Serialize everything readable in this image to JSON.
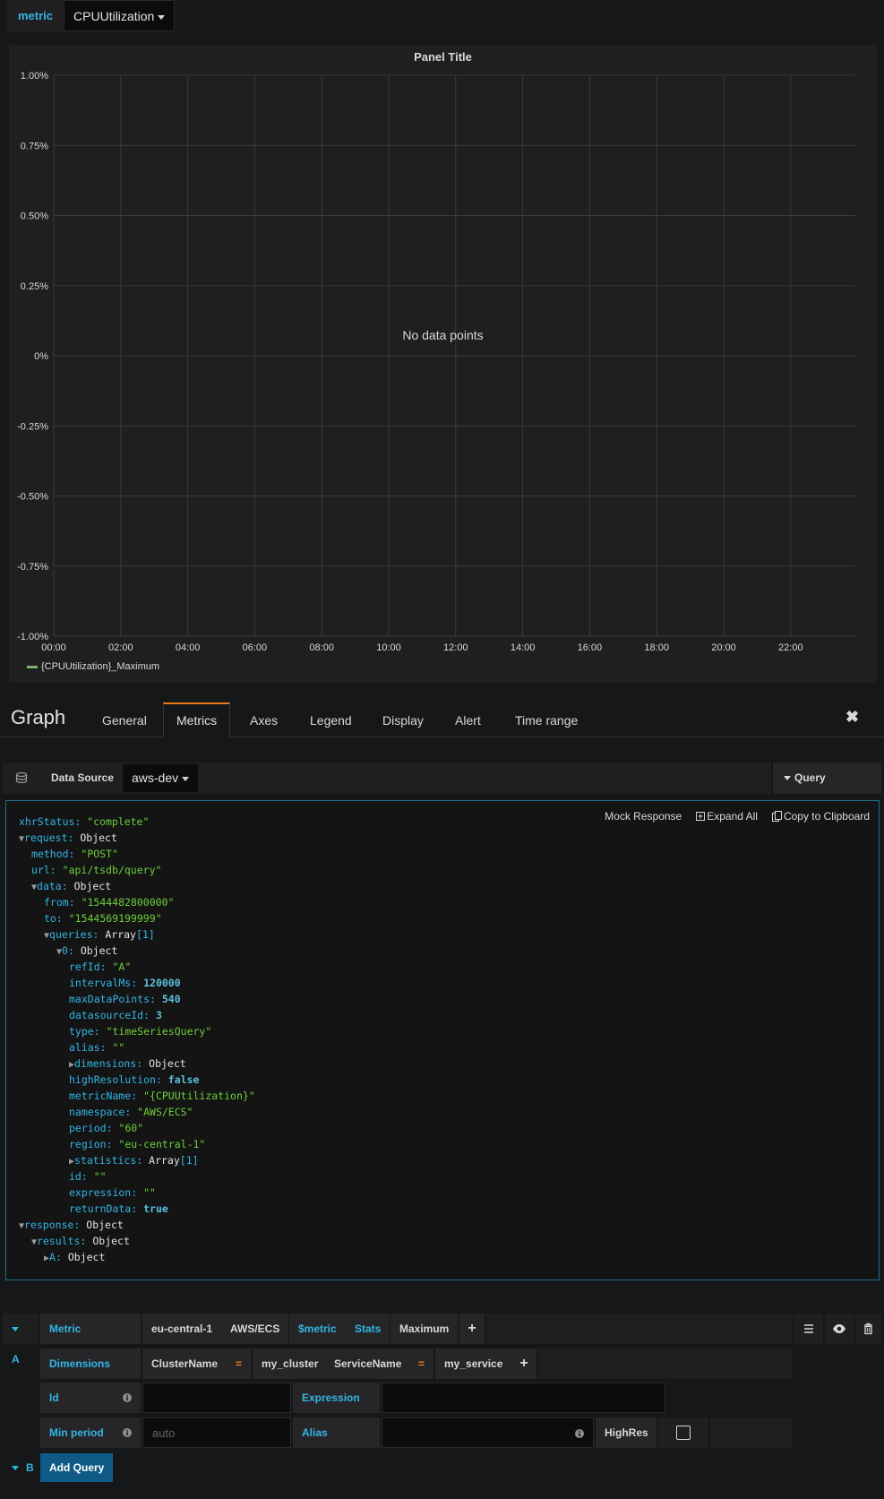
{
  "variable": {
    "label": "metric",
    "value": "CPUUtilization"
  },
  "panel": {
    "title": "Panel Title",
    "no_data": "No data points",
    "legend": "{CPUUtilization}_Maximum"
  },
  "chart_data": {
    "type": "line",
    "title": "Panel Title",
    "y_ticks": [
      "1.00%",
      "0.75%",
      "0.50%",
      "0.25%",
      "0%",
      "-0.25%",
      "-0.50%",
      "-0.75%",
      "-1.00%"
    ],
    "x_ticks": [
      "00:00",
      "02:00",
      "04:00",
      "06:00",
      "08:00",
      "10:00",
      "12:00",
      "14:00",
      "16:00",
      "18:00",
      "20:00",
      "22:00"
    ],
    "ylim": [
      -1.0,
      1.0
    ],
    "grid": true,
    "series": [
      {
        "name": "{CPUUtilization}_Maximum",
        "values": [],
        "color": "#7eb26d"
      }
    ],
    "legend_position": "bottom-left"
  },
  "editor": {
    "title": "Graph",
    "tabs": [
      "General",
      "Metrics",
      "Axes",
      "Legend",
      "Display",
      "Alert",
      "Time range"
    ],
    "active_tab": "Metrics",
    "close": "✖"
  },
  "datasource": {
    "label": "Data Source",
    "value": "aws-dev",
    "inspector": "Query Inspector"
  },
  "inspector": {
    "actions": {
      "mock": "Mock Response",
      "expand": "Expand All",
      "copy": "Copy to Clipboard"
    },
    "lines": [
      {
        "d": 0,
        "t": "",
        "k": "xhrStatus",
        "v": "\"complete\"",
        "c": "s"
      },
      {
        "d": 0,
        "t": "▼",
        "k": "request",
        "v": "Object",
        "c": "o"
      },
      {
        "d": 1,
        "t": "",
        "k": "method",
        "v": "\"POST\"",
        "c": "s"
      },
      {
        "d": 1,
        "t": "",
        "k": "url",
        "v": "\"api/tsdb/query\"",
        "c": "s"
      },
      {
        "d": 1,
        "t": "▼",
        "k": "data",
        "v": "Object",
        "c": "o"
      },
      {
        "d": 2,
        "t": "",
        "k": "from",
        "v": "\"1544482800000\"",
        "c": "s"
      },
      {
        "d": 2,
        "t": "",
        "k": "to",
        "v": "\"1544569199999\"",
        "c": "s"
      },
      {
        "d": 2,
        "t": "▼",
        "k": "queries",
        "v": "Array",
        "c": "a",
        "n": "[1]"
      },
      {
        "d": 3,
        "t": "▼",
        "k": "0",
        "v": "Object",
        "c": "o"
      },
      {
        "d": 4,
        "t": "",
        "k": "refId",
        "v": "\"A\"",
        "c": "s"
      },
      {
        "d": 4,
        "t": "",
        "k": "intervalMs",
        "v": "120000",
        "c": "n"
      },
      {
        "d": 4,
        "t": "",
        "k": "maxDataPoints",
        "v": "540",
        "c": "n"
      },
      {
        "d": 4,
        "t": "",
        "k": "datasourceId",
        "v": "3",
        "c": "n"
      },
      {
        "d": 4,
        "t": "",
        "k": "type",
        "v": "\"timeSeriesQuery\"",
        "c": "s"
      },
      {
        "d": 4,
        "t": "",
        "k": "alias",
        "v": "\"\"",
        "c": "s"
      },
      {
        "d": 4,
        "t": "▶",
        "k": "dimensions",
        "v": "Object",
        "c": "o"
      },
      {
        "d": 4,
        "t": "",
        "k": "highResolution",
        "v": "false",
        "c": "b"
      },
      {
        "d": 4,
        "t": "",
        "k": "metricName",
        "v": "\"{CPUUtilization}\"",
        "c": "s"
      },
      {
        "d": 4,
        "t": "",
        "k": "namespace",
        "v": "\"AWS/ECS\"",
        "c": "s"
      },
      {
        "d": 4,
        "t": "",
        "k": "period",
        "v": "\"60\"",
        "c": "s"
      },
      {
        "d": 4,
        "t": "",
        "k": "region",
        "v": "\"eu-central-1\"",
        "c": "s"
      },
      {
        "d": 4,
        "t": "▶",
        "k": "statistics",
        "v": "Array",
        "c": "a",
        "n": "[1]"
      },
      {
        "d": 4,
        "t": "",
        "k": "id",
        "v": "\"\"",
        "c": "s"
      },
      {
        "d": 4,
        "t": "",
        "k": "expression",
        "v": "\"\"",
        "c": "s"
      },
      {
        "d": 4,
        "t": "",
        "k": "returnData",
        "v": "true",
        "c": "b"
      },
      {
        "d": 0,
        "t": "▼",
        "k": "response",
        "v": "Object",
        "c": "o"
      },
      {
        "d": 1,
        "t": "▼",
        "k": "results",
        "v": "Object",
        "c": "o"
      },
      {
        "d": 2,
        "t": "▶",
        "k": "A",
        "v": "Object",
        "c": "o"
      }
    ]
  },
  "query_a": {
    "ref": "A",
    "metric_label": "Metric",
    "region": "eu-central-1",
    "namespace": "AWS/ECS",
    "metric": "$metric",
    "stats_label": "Stats",
    "stat": "Maximum",
    "plus": "+",
    "dimensions_label": "Dimensions",
    "dim1_key": "ClusterName",
    "dim1_val": "my_cluster",
    "dim2_key": "ServiceName",
    "dim2_val": "my_service",
    "eq": "=",
    "id_label": "Id",
    "expression_label": "Expression",
    "min_period_label": "Min period",
    "min_period_placeholder": "auto",
    "alias_label": "Alias",
    "highres_label": "HighRes"
  },
  "query_b": {
    "ref": "B",
    "add_query": "Add Query"
  }
}
